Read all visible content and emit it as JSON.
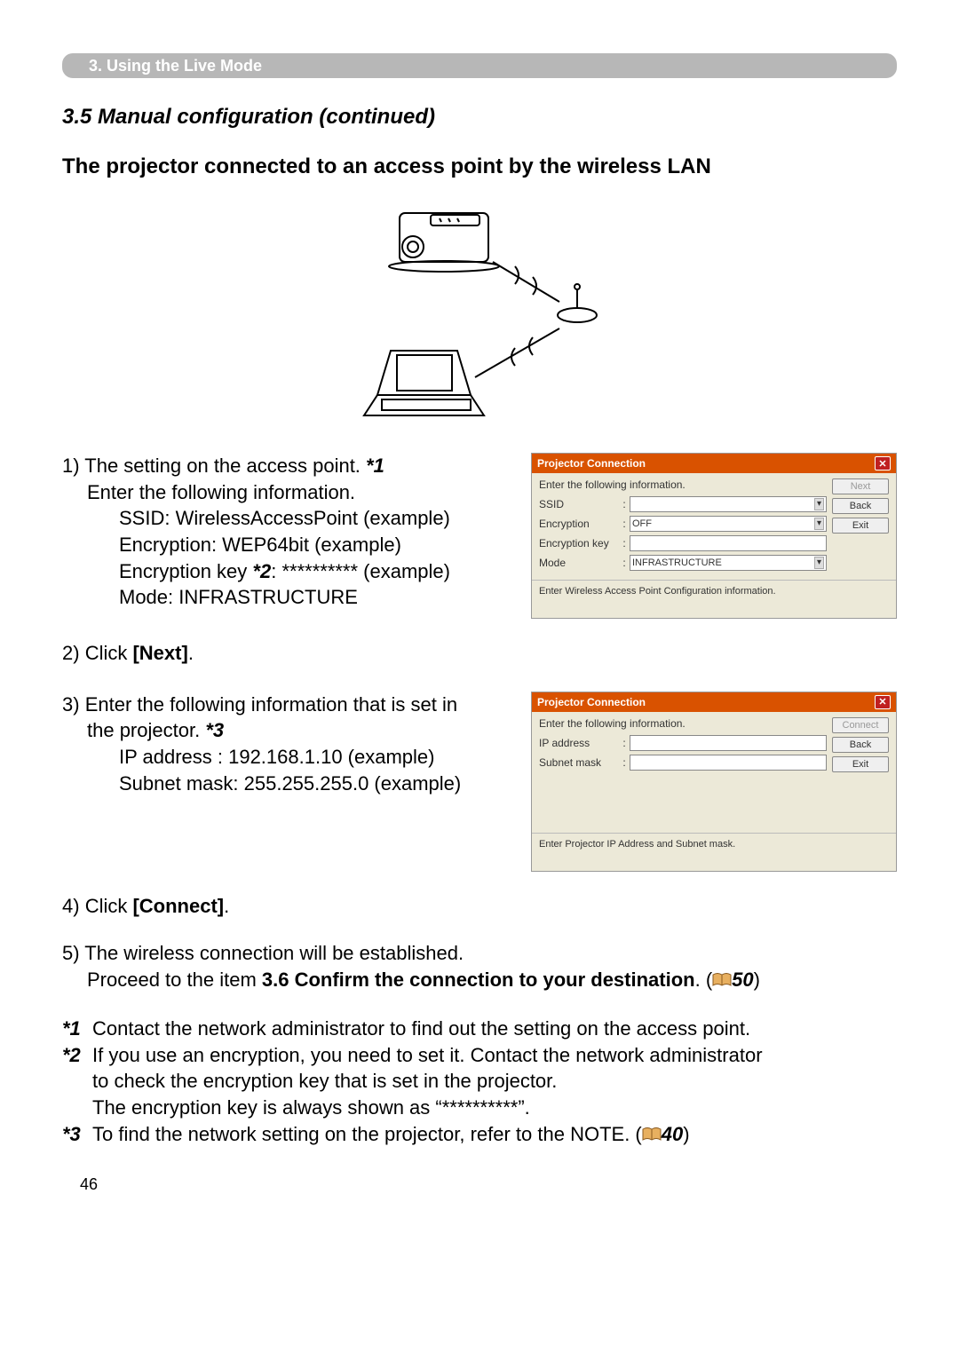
{
  "section_bar": "3. Using the Live Mode",
  "subtitle": "3.5 Manual configuration (continued)",
  "heading": "The projector connected to an access point by the wireless LAN",
  "step1": {
    "num": "1)",
    "line1": "The setting on the access point.",
    "ref1": "*1",
    "line2": "Enter the following information.",
    "ssid_line": "SSID: WirelessAccessPoint (example)",
    "enc_line": "Encryption: WEP64bit (example)",
    "enckey_prefix": "Encryption key",
    "enckey_ref": "*2",
    "enckey_suffix": ": ********** (example)",
    "mode_line": "Mode: INFRASTRUCTURE"
  },
  "dialog1": {
    "title": "Projector Connection",
    "prompt": "Enter the following information.",
    "labels": {
      "ssid": "SSID",
      "encryption": "Encryption",
      "encryption_key": "Encryption key",
      "mode": "Mode"
    },
    "values": {
      "encryption": "OFF",
      "mode": "INFRASTRUCTURE"
    },
    "buttons": {
      "next": "Next",
      "back": "Back",
      "exit": "Exit"
    },
    "status": "Enter Wireless Access Point Configuration information."
  },
  "step2": {
    "num": "2)",
    "prefix": "Click ",
    "bold": "[Next]",
    "suffix": "."
  },
  "step3": {
    "num": "3)",
    "line1_a": "Enter the following information that is set in",
    "line1_b": "the projector.",
    "ref3": "*3",
    "ip_line": "IP address : 192.168.1.10 (example)",
    "mask_line": "Subnet mask: 255.255.255.0 (example)"
  },
  "dialog2": {
    "title": "Projector Connection",
    "prompt": "Enter the following information.",
    "labels": {
      "ip": "IP address",
      "mask": "Subnet mask"
    },
    "buttons": {
      "connect": "Connect",
      "back": "Back",
      "exit": "Exit"
    },
    "status": "Enter Projector IP Address and Subnet mask."
  },
  "step4": {
    "num": "4)",
    "prefix": "Click ",
    "bold": "[Connect]",
    "suffix": "."
  },
  "step5": {
    "num": "5)",
    "line1": "The wireless connection will be established.",
    "line2_a": "Proceed to the item ",
    "line2_bold": "3.6 Confirm the connection to your destination",
    "line2_b": ". (",
    "page_ref": "50",
    "line2_c": ")"
  },
  "footnotes": {
    "f1": {
      "key": "*1",
      "text": "Contact the network administrator to find out the setting on the access point."
    },
    "f2": {
      "key": "*2",
      "l1": "If you use an encryption, you need to set it. Contact the network administrator",
      "l2": "to check the encryption key that is set in the projector.",
      "l3": "The encryption key is always shown as “**********”."
    },
    "f3": {
      "key": "*3",
      "text_a": "To find the network setting on the projector, refer to the NOTE. (",
      "page_ref": "40",
      "text_b": ")"
    }
  },
  "page_number": "46"
}
